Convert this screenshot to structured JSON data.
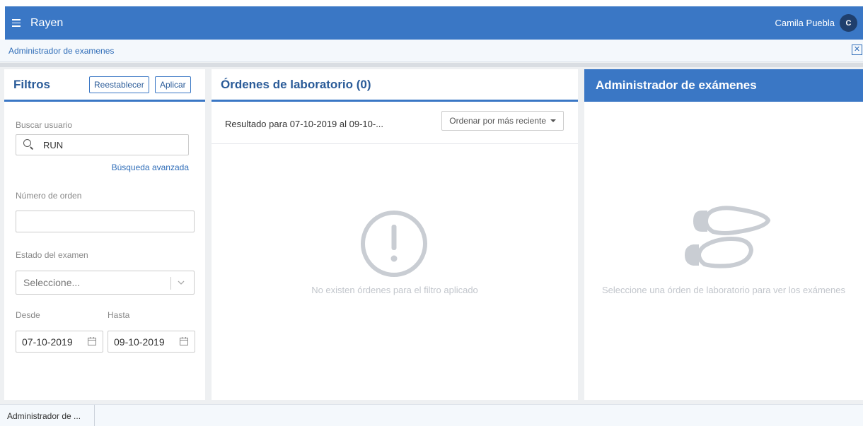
{
  "app": {
    "name": "Rayen"
  },
  "user": {
    "name": "Camila Puebla",
    "initial": "C"
  },
  "subbar": {
    "title": "Administrador de examenes",
    "close_label": "✕"
  },
  "filters": {
    "title": "Filtros",
    "reset_label": "Reestablecer",
    "apply_label": "Aplicar",
    "search_label": "Buscar usuario",
    "search_placeholder": "RUN",
    "advanced_link": "Búsqueda avanzada",
    "order_label": "Número de orden",
    "status_label": "Estado del examen",
    "status_value": "Seleccione...",
    "from_label": "Desde",
    "to_label": "Hasta",
    "from_value": "07-10-2019",
    "to_value": "09-10-2019"
  },
  "orders": {
    "title": "Órdenes de laboratorio (0)",
    "result_text": "Resultado para 07-10-2019 al 09-10-...",
    "sort_label": "Ordenar por más reciente",
    "empty_text": "No existen órdenes para el filtro aplicado"
  },
  "exams": {
    "title": "Administrador de exámenes",
    "empty_text": "Seleccione una órden de laboratorio para ver los exámenes"
  },
  "bottom": {
    "tab_label": "Administrador de ..."
  },
  "colors": {
    "primary": "#3a77c5",
    "muted": "#c2c6cc"
  },
  "icons": [
    "menu-icon",
    "search-icon",
    "chevron-down-icon",
    "calendar-icon",
    "exclamation-circle-icon",
    "footprints-icon",
    "close-icon"
  ]
}
